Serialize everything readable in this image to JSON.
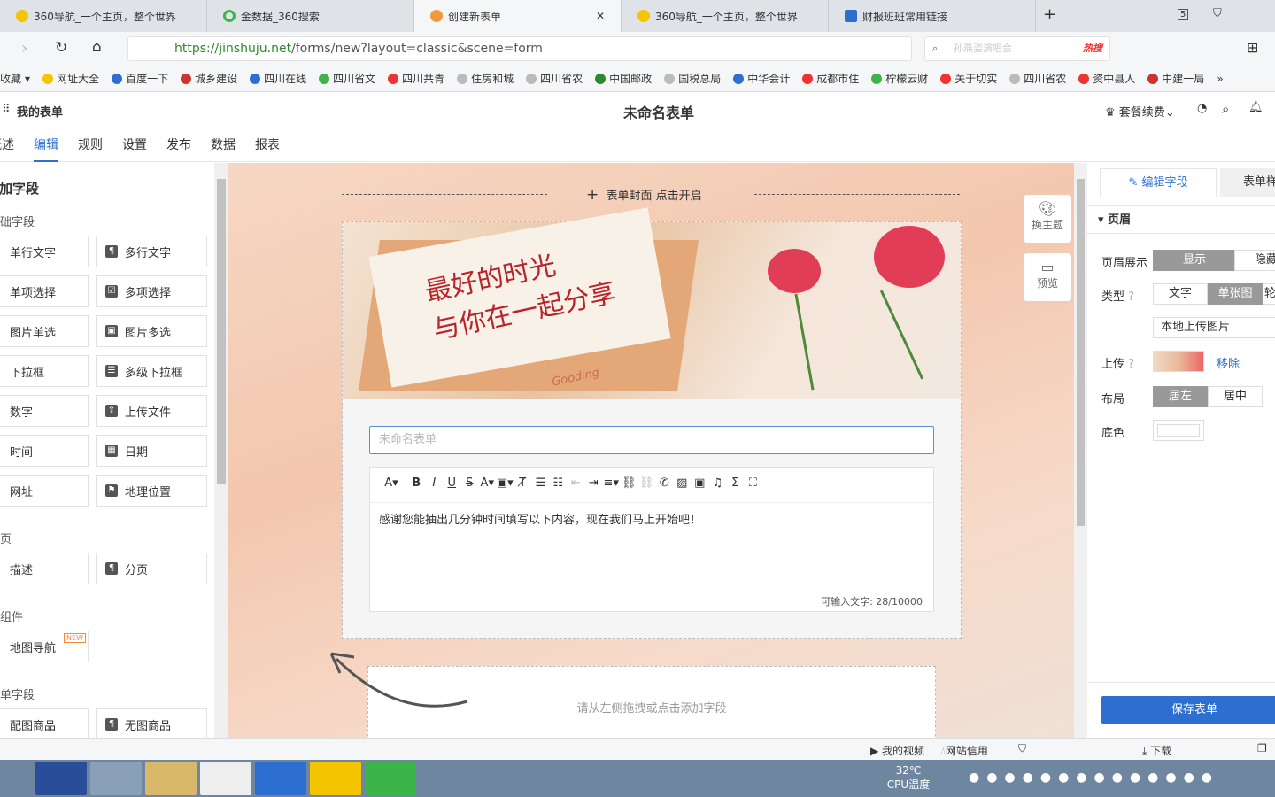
{
  "browser": {
    "tabs": [
      {
        "label": "360导航_一个主页，整个世界",
        "active": false
      },
      {
        "label": "金数据_360搜索",
        "active": false
      },
      {
        "label": "创建新表单",
        "active": true
      },
      {
        "label": "360导航_一个主页，整个世界",
        "active": false
      },
      {
        "label": "财报班班常用链接",
        "active": false
      }
    ],
    "tab_count": "5",
    "url_scheme": "https://",
    "url_host": "jinshuju.net",
    "url_path": "/forms/new?layout=classic&scene=form",
    "search_placeholder": "孙燕姿演唱会",
    "search_hot": "热搜",
    "bookmarks": [
      "收藏",
      "网址大全",
      "百度一下",
      "城乡建设",
      "四川在线",
      "四川省文",
      "四川共青",
      "住房和城",
      "四川省农",
      "中国邮政",
      "国税总局",
      "中华会计",
      "成都市住",
      "柠檬云财",
      "关于切实",
      "四川省农",
      "资中县人",
      "中建一局"
    ]
  },
  "app": {
    "my_forms": "我的表单",
    "title": "未命名表单",
    "plan": "套餐续费",
    "nav": [
      {
        "label": "概述"
      },
      {
        "label": "编辑",
        "active": true
      },
      {
        "label": "规则"
      },
      {
        "label": "设置"
      },
      {
        "label": "发布"
      },
      {
        "label": "数据"
      },
      {
        "label": "报表"
      }
    ]
  },
  "left": {
    "title": "添加字段",
    "basic": "基础字段",
    "basic_fields": [
      "单行文字",
      "多行文字",
      "单项选择",
      "多项选择",
      "图片单选",
      "图片多选",
      "下拉框",
      "多级下拉框",
      "数字",
      "上传文件",
      "时间",
      "日期",
      "网址",
      "地理位置"
    ],
    "page": "分页",
    "page_fields": [
      "描述",
      "分页"
    ],
    "widgets": "小组件",
    "map_nav": "地图导航",
    "new_badge": "NEW",
    "order": "订单字段",
    "order_fields": [
      "配图商品",
      "无图商品"
    ]
  },
  "canvas": {
    "cover": "表单封面 点击开启",
    "theme": "换主题",
    "preview": "预览",
    "banner_text": [
      "最好的时光",
      "与你在一起分享"
    ],
    "banner_sign": "Gooding",
    "title_placeholder": "未命名表单",
    "description": "感谢您能抽出几分钟时间填写以下内容，现在我们马上开始吧！",
    "char_count": "可输入文字: 28/10000",
    "drop_hint": "请从左侧拖拽或点击添加字段"
  },
  "right": {
    "tab_edit": "编辑字段",
    "tab_style": "表单样式",
    "section": "页眉",
    "header_display": "页眉展示",
    "show": "显示",
    "hide": "隐藏",
    "type": "类型",
    "type_text": "文字",
    "type_single": "单张图",
    "type_multi": "轮播",
    "upload_local": "本地上传图片",
    "upload": "上传",
    "remove": "移除",
    "layout": "布局",
    "left": "居左",
    "center": "居中",
    "bgcolor": "底色",
    "save": "保存表单",
    "accent": "#2d6fd1"
  },
  "status": {
    "items": [
      "我的视频",
      "网站信用",
      "下载"
    ]
  },
  "taskbar": {
    "temp": "32℃",
    "cpu": "CPU温度"
  }
}
